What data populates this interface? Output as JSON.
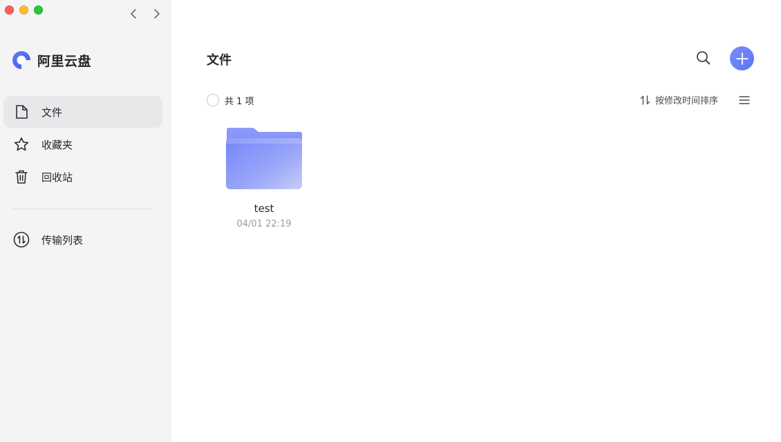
{
  "app": {
    "name": "阿里云盘"
  },
  "sidebar": {
    "items": [
      {
        "label": "文件",
        "icon": "file-icon",
        "active": true
      },
      {
        "label": "收藏夹",
        "icon": "star-icon",
        "active": false
      },
      {
        "label": "回收站",
        "icon": "trash-icon",
        "active": false
      }
    ],
    "transfer": {
      "label": "传输列表",
      "icon": "transfer-icon"
    }
  },
  "main": {
    "title": "文件",
    "count_text": "共 1 项",
    "sort_label": "按修改时间排序",
    "files": [
      {
        "name": "test",
        "date": "04/01 22:19",
        "type": "folder"
      }
    ]
  },
  "colors": {
    "accent": "#6a81f8",
    "sidebar_bg": "#f4f4f5",
    "active_item_bg": "#e8e8ea"
  }
}
